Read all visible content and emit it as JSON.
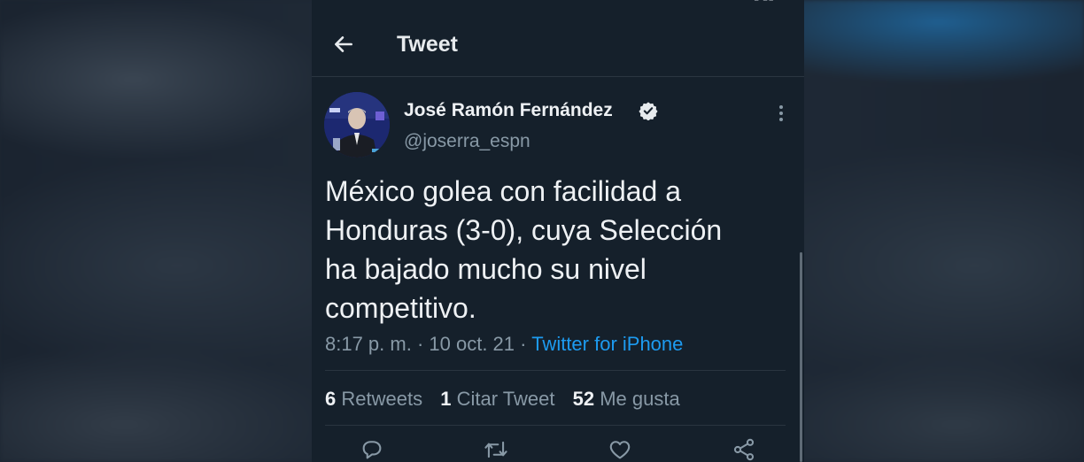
{
  "colors": {
    "background": "#15202b",
    "text_primary": "#eef1f4",
    "text_secondary": "#8899a6",
    "accent": "#1d9bf0",
    "divider": "#2a3540"
  },
  "header": {
    "title": "Tweet",
    "back_icon": "arrow-left-icon"
  },
  "tweet": {
    "author": {
      "name": "José Ramón Fernández",
      "handle": "@joserra_espn",
      "verified_icon": "verified-badge-icon"
    },
    "more_icon": "more-vertical-icon",
    "text": "México golea con facilidad a\nHonduras (3-0), cuya Selección\nha bajado mucho su nivel\ncompetitivo.",
    "time": "8:17 p. m.",
    "separator": " · ",
    "date": "10 oct. 21",
    "source": "Twitter for iPhone"
  },
  "stats": {
    "retweets": {
      "count": "6",
      "label": "Retweets"
    },
    "quotes": {
      "count": "1",
      "label": "Citar Tweet"
    },
    "likes": {
      "count": "52",
      "label": "Me gusta"
    }
  },
  "actions": [
    "reply-icon",
    "retweet-icon",
    "like-icon",
    "share-icon"
  ]
}
